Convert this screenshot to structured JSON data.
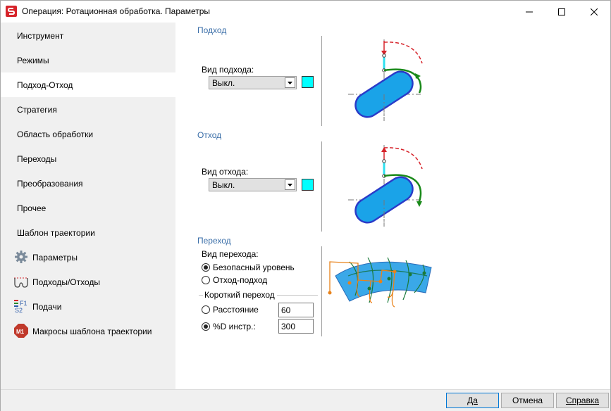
{
  "window": {
    "title": "Операция: Ротационная обработка. Параметры"
  },
  "sidebar": {
    "items": [
      {
        "label": "Инструмент"
      },
      {
        "label": "Режимы"
      },
      {
        "label": "Подход-Отход"
      },
      {
        "label": "Стратегия"
      },
      {
        "label": "Область обработки"
      },
      {
        "label": "Переходы"
      },
      {
        "label": "Преобразования"
      },
      {
        "label": "Прочее"
      },
      {
        "label": "Шаблон траектории"
      },
      {
        "label": "Параметры",
        "icon": "gear-icon"
      },
      {
        "label": "Подходы/Отходы",
        "icon": "approach-path-icon"
      },
      {
        "label": "Подачи",
        "icon": "feeds-icon"
      },
      {
        "label": "Макросы шаблона траектории",
        "icon": "macro-m1-icon"
      }
    ]
  },
  "approach": {
    "title": "Подход",
    "type_label": "Вид подхода:",
    "type_value": "Выкл.",
    "color": "#00ffff"
  },
  "retract": {
    "title": "Отход",
    "type_label": "Вид отхода:",
    "type_value": "Выкл.",
    "color": "#00ffff"
  },
  "transition": {
    "title": "Переход",
    "type_label": "Вид перехода:",
    "option_safe": "Безопасный уровень",
    "option_retract_approach": "Отход-подход",
    "selected": "Безопасный уровень",
    "short_group": "Короткий переход",
    "distance_label": "Расстояние",
    "distance_value": "60",
    "percent_label": "%D инстр.:",
    "percent_value": "300",
    "short_selected": "%D инстр.:"
  },
  "buttons": {
    "ok": "Да",
    "cancel": "Отмена",
    "help": "Справка"
  }
}
